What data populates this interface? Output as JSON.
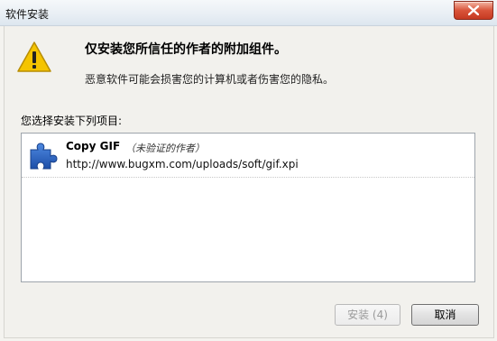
{
  "window": {
    "title": "软件安装"
  },
  "dialog": {
    "headline": "仅安装您所信任的作者的附加组件。",
    "warning_text": "恶意软件可能会损害您的计算机或者伤害您的隐私。",
    "list_label": "您选择安装下列项目:"
  },
  "addons": [
    {
      "name": "Copy GIF",
      "note": "（未验证的作者）",
      "url": "http://www.bugxm.com/uploads/soft/gif.xpi",
      "icon": "puzzle-piece-icon"
    }
  ],
  "buttons": {
    "install_label": "安装 (4)",
    "install_enabled": false,
    "cancel_label": "取消"
  },
  "colors": {
    "close_button": "#c63a22",
    "warning_yellow": "#f5c400",
    "addon_icon_blue": "#2a63c8"
  }
}
